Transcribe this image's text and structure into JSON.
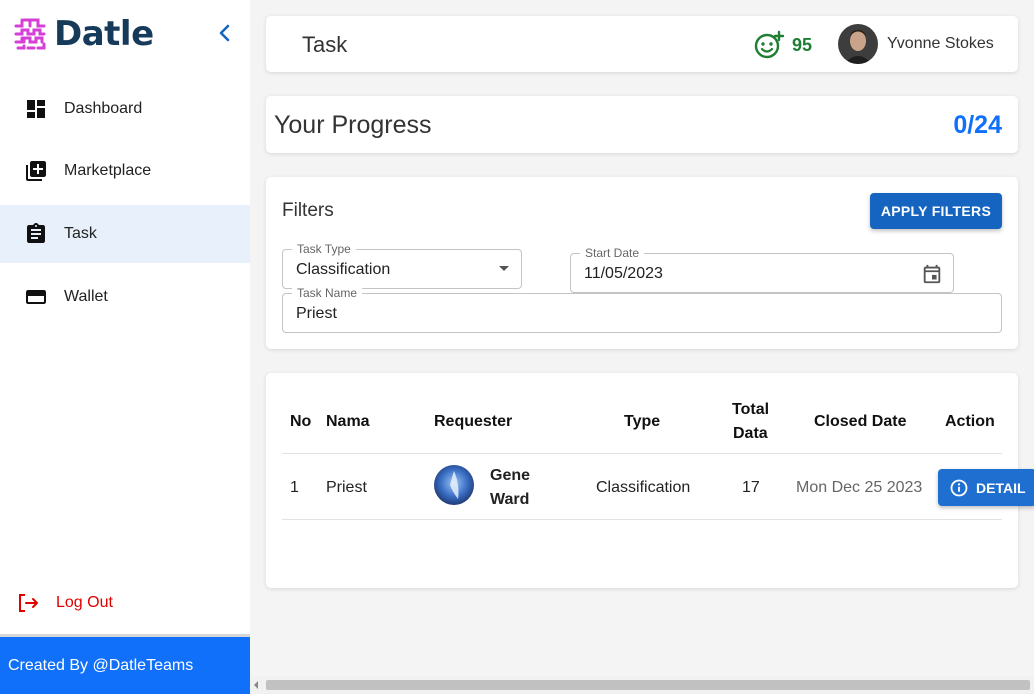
{
  "brand": {
    "name": "Datle",
    "accent": "#d63fd6"
  },
  "sidebar": {
    "items": [
      {
        "label": "Dashboard",
        "icon": "dashboard-icon",
        "active": false
      },
      {
        "label": "Marketplace",
        "icon": "add-box-icon",
        "active": false
      },
      {
        "label": "Task",
        "icon": "clipboard-icon",
        "active": true
      },
      {
        "label": "Wallet",
        "icon": "wallet-icon",
        "active": false
      }
    ],
    "logout_label": "Log Out",
    "footer_text": "Created By @DatleTeams"
  },
  "header": {
    "title": "Task",
    "score": "95",
    "user_name": "Yvonne Stokes"
  },
  "progress": {
    "label": "Your Progress",
    "value": "0/24"
  },
  "filters": {
    "title": "Filters",
    "apply_label": "APPLY FILTERS",
    "task_type": {
      "legend": "Task Type",
      "value": "Classification"
    },
    "start_date": {
      "legend": "Start Date",
      "value": "11/05/2023"
    },
    "task_name": {
      "legend": "Task Name",
      "value": "Priest"
    }
  },
  "table": {
    "headers": {
      "no": "No",
      "nama": "Nama",
      "requester": "Requester",
      "type": "Type",
      "total_data_1": "Total",
      "total_data_2": "Data",
      "closed_date": "Closed Date",
      "action": "Action"
    },
    "rows": [
      {
        "no": "1",
        "nama": "Priest",
        "requester_first": "Gene",
        "requester_last": "Ward",
        "type": "Classification",
        "total_data": "17",
        "closed_date": "Mon Dec 25 2023",
        "action_label": "DETAIL"
      }
    ]
  },
  "colors": {
    "primary": "#1170fa",
    "button": "#1565c0",
    "score": "#1e7e34",
    "logout": "#e00000",
    "active_bg": "#e8f1fb"
  }
}
